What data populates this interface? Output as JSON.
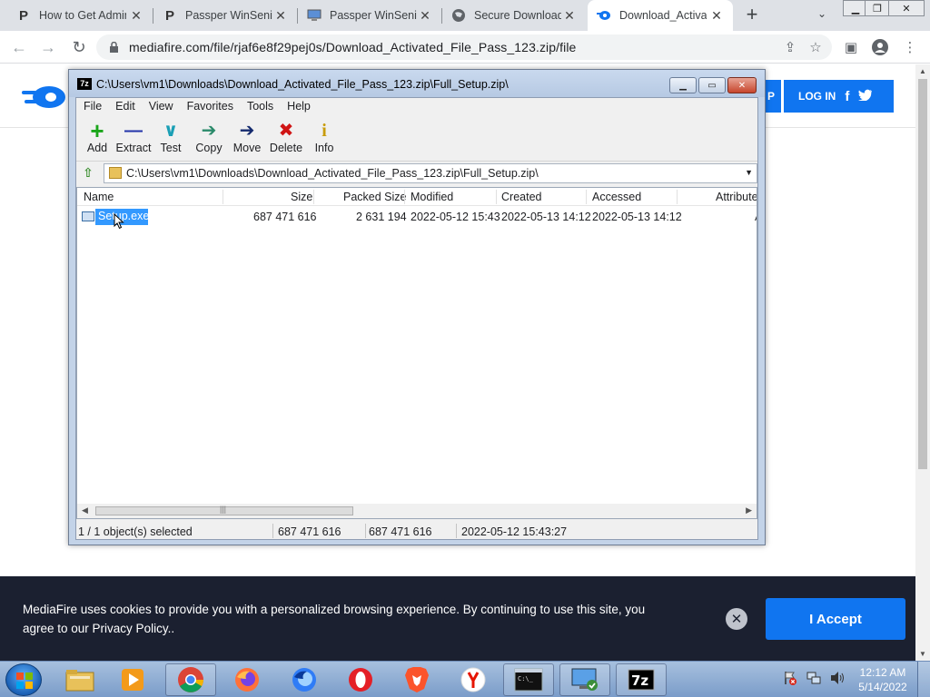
{
  "browser": {
    "tabs": [
      {
        "title": "How to Get Admin",
        "icon": "P",
        "active": false
      },
      {
        "title": "Passper WinSenic",
        "icon": "P",
        "active": false
      },
      {
        "title": "Passper WinSenic",
        "icon": "monitor",
        "active": false
      },
      {
        "title": "Secure Download",
        "icon": "globe",
        "active": false
      },
      {
        "title": "Download_Activat",
        "icon": "mediafire",
        "active": true
      }
    ],
    "url": "mediafire.com/file/rjaf6e8f29pej0s/Download_Activated_File_Pass_123.zip/file"
  },
  "mediafire": {
    "sign_label": "P",
    "login_label": "LOG IN",
    "facebook": "f",
    "twitter": "t",
    "cookie_text": "MediaFire uses cookies to provide you with a personalized browsing experience. By continuing to use this site, you agree to our Privacy Policy..",
    "accept_label": "I Accept"
  },
  "sevenzip": {
    "title": "C:\\Users\\vm1\\Downloads\\Download_Activated_File_Pass_123.zip\\Full_Setup.zip\\",
    "app_icon": "7z",
    "menu": [
      "File",
      "Edit",
      "View",
      "Favorites",
      "Tools",
      "Help"
    ],
    "tools": [
      {
        "label": "Add",
        "glyph": "+",
        "color": "#1aa51a"
      },
      {
        "label": "Extract",
        "glyph": "—",
        "color": "#2233aa"
      },
      {
        "label": "Test",
        "glyph": "∨",
        "color": "#1a9fb5"
      },
      {
        "label": "Copy",
        "glyph": "➔",
        "color": "#2a8a6a"
      },
      {
        "label": "Move",
        "glyph": "➔",
        "color": "#142a6e"
      },
      {
        "label": "Delete",
        "glyph": "✖",
        "color": "#d01515"
      },
      {
        "label": "Info",
        "glyph": "i",
        "color": "#c89c0c"
      }
    ],
    "path": "C:\\Users\\vm1\\Downloads\\Download_Activated_File_Pass_123.zip\\Full_Setup.zip\\",
    "columns": [
      "Name",
      "Size",
      "Packed Size",
      "Modified",
      "Created",
      "Accessed",
      "Attribute"
    ],
    "rows": [
      {
        "name": "Setup.exe",
        "size": "687 471 616",
        "packed": "2 631 194",
        "modified": "2022-05-12 15:43",
        "created": "2022-05-13 14:12",
        "accessed": "2022-05-13 14:12",
        "attr": "A"
      }
    ],
    "status": {
      "selected": "1 / 1 object(s) selected",
      "size": "687 471 616",
      "packed": "687 471 616",
      "date": "2022-05-12 15:43:27"
    }
  },
  "taskbar": {
    "time": "12:12 AM",
    "date": "5/14/2022",
    "apps": [
      "explorer",
      "media-player",
      "chrome",
      "firefox",
      "firefox-dev",
      "opera",
      "brave",
      "yandex",
      "cmd",
      "remote-desktop",
      "7zip"
    ]
  }
}
